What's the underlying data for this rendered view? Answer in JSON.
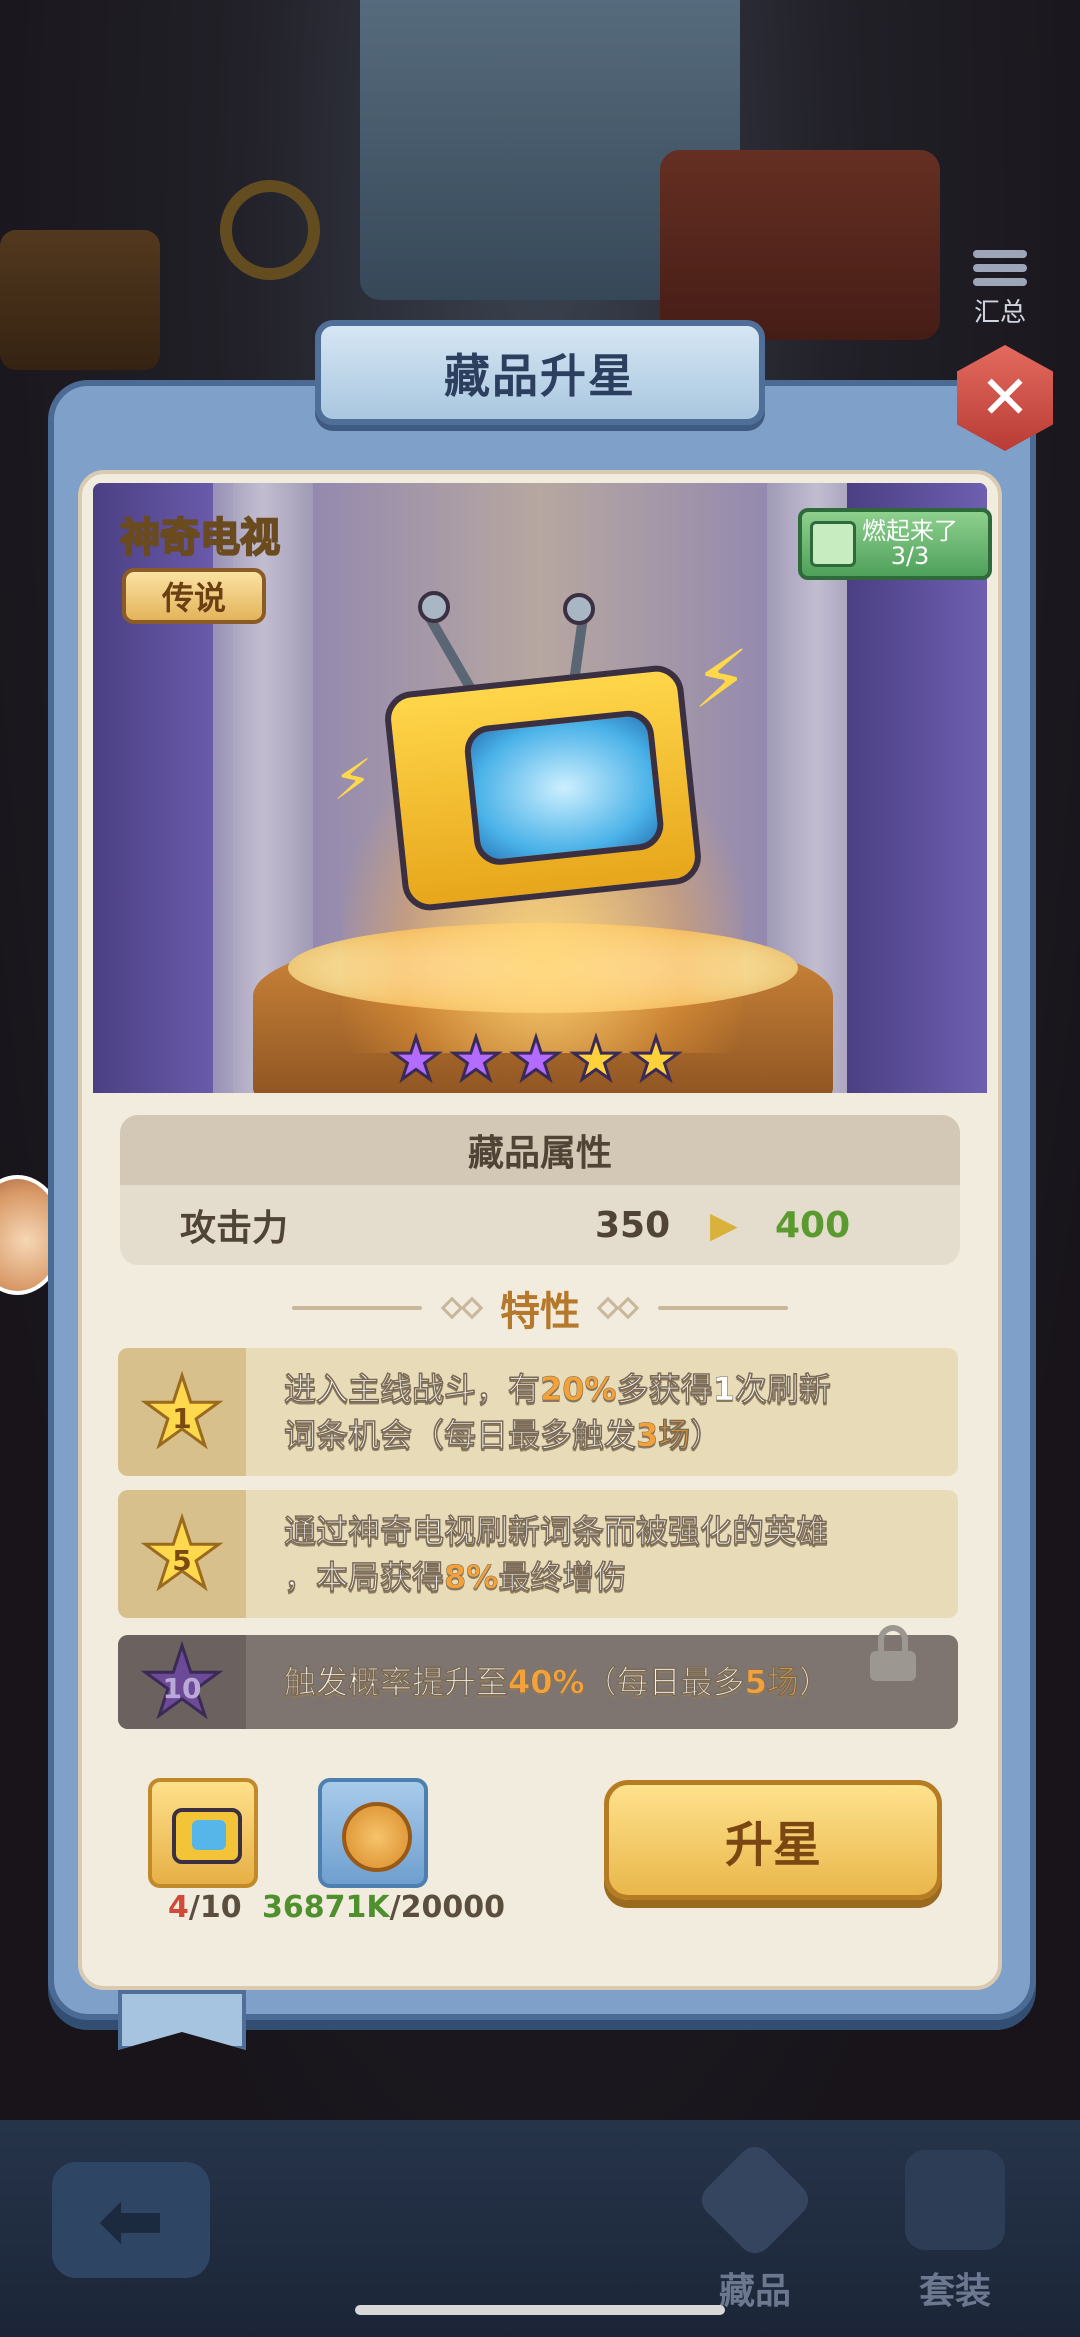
{
  "dialog": {
    "title": "藏品升星",
    "close_icon": "close-icon"
  },
  "summary": {
    "label": "汇总"
  },
  "collection": {
    "name": "神奇电视",
    "rarity": "传说",
    "set_badge": {
      "title": "燃起来了",
      "progress": "3/3"
    },
    "stars": {
      "purple": 3,
      "gold": 2,
      "total": 5
    }
  },
  "attributes": {
    "header": "藏品属性",
    "rows": [
      {
        "label": "攻击力",
        "current": "350",
        "next": "400"
      }
    ]
  },
  "traits": {
    "header": "特性",
    "items": [
      {
        "level": "1",
        "line1": [
          "进入主线战斗，有",
          "20%",
          "多获得1次刷新"
        ],
        "line2": [
          "词条机会（每日最多触发",
          "3场",
          "）"
        ],
        "locked": false
      },
      {
        "level": "5",
        "line1": [
          "通过神奇电视刷新词条而被强化的英雄",
          "",
          ""
        ],
        "line2": [
          "，本局获得",
          "8%",
          "最终增伤"
        ],
        "locked": false
      },
      {
        "level": "10",
        "line1": [
          "触发概率提升至",
          "40%",
          "（每日最多",
          "5场",
          "）"
        ],
        "locked": true
      }
    ]
  },
  "materials": {
    "item": {
      "have": "4",
      "need": "/10"
    },
    "coin": {
      "have": "36871K",
      "need": "/20000"
    }
  },
  "upgrade_button": "升星",
  "bottom_nav": {
    "back_icon": "arrow-left-icon",
    "items": [
      {
        "label": "藏品",
        "active": true
      },
      {
        "label": "套装",
        "active": false
      }
    ]
  },
  "colors": {
    "highlight": "#f3a13a",
    "increase": "#5a9a2f",
    "insufficient": "#d04a3a"
  }
}
